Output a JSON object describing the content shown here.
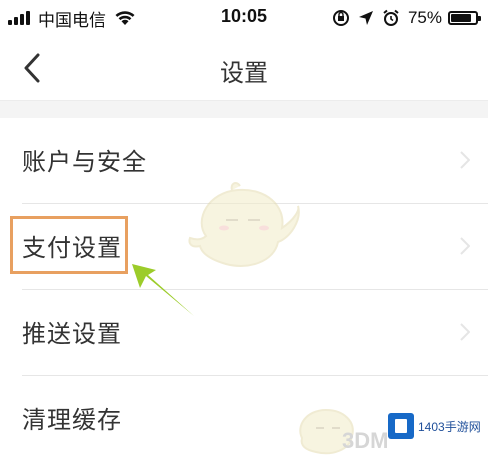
{
  "status_bar": {
    "carrier": "中国电信",
    "time": "10:05",
    "battery_percent": "75%",
    "battery_level": 0.75
  },
  "nav": {
    "title": "设置",
    "back_icon": "chevron-left-icon"
  },
  "settings": {
    "items": [
      {
        "label": "账户与安全"
      },
      {
        "label": "支付设置"
      },
      {
        "label": "推送设置"
      },
      {
        "label": "清理缓存"
      }
    ]
  },
  "annotations": {
    "highlight_color": "#e8a060",
    "arrow_color": "#9ccc2a"
  },
  "watermark": {
    "text": "3DM",
    "brand": "1403手游网"
  }
}
